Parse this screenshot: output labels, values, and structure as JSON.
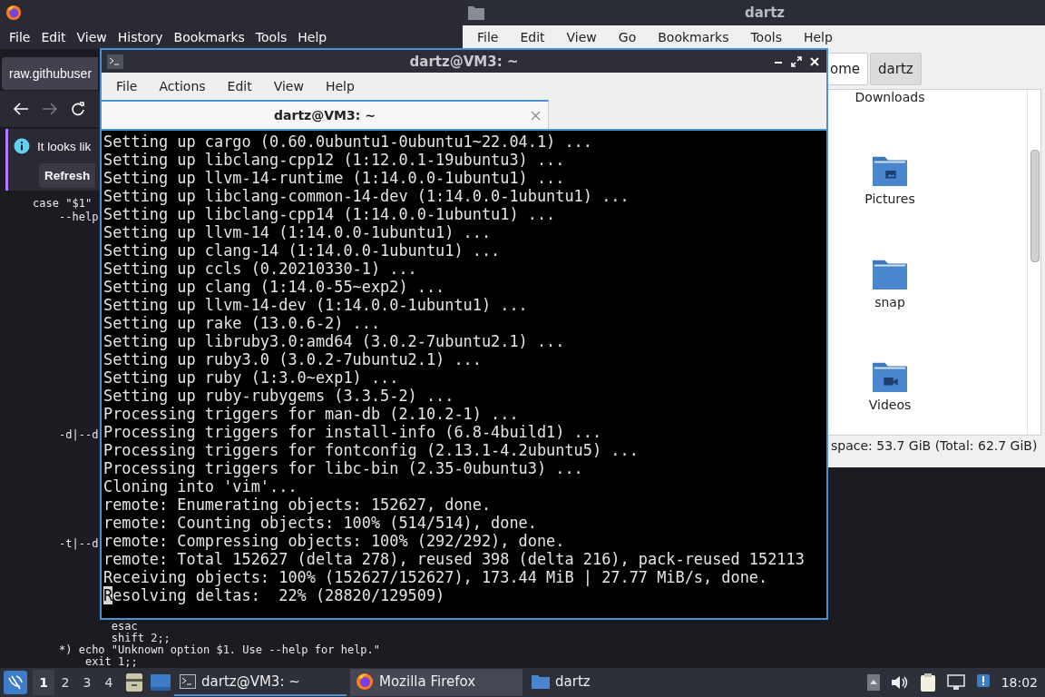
{
  "browser": {
    "menu": [
      "File",
      "Edit",
      "View",
      "History",
      "Bookmarks",
      "Tools",
      "Help"
    ],
    "tab": {
      "title": "raw.githubuser"
    },
    "notification": {
      "text": "It looks lik",
      "button": "Refresh"
    },
    "code_lines": [
      "     case \"$1\"",
      "         --help",
      "         -d|--d",
      "         -t|--d",
      "                 esac",
      "                 shift 2;;",
      "         *) echo \"Unknown option $1. Use --help for help.\"",
      "             exit 1;;"
    ]
  },
  "file_manager": {
    "title": "dartz",
    "menu": [
      "File",
      "Edit",
      "View",
      "Go",
      "Bookmarks",
      "Tools",
      "Help"
    ],
    "path": [
      {
        "label": "ome",
        "selected": false
      },
      {
        "label": "dartz",
        "selected": true
      }
    ],
    "items": [
      {
        "name": "Downloads"
      },
      {
        "name": "Pictures",
        "kind": "pictures"
      },
      {
        "name": "snap",
        "kind": "plain"
      },
      {
        "name": "Videos",
        "kind": "videos"
      }
    ],
    "status": "space: 53.7 GiB (Total: 62.7 GiB)"
  },
  "terminal": {
    "title": "dartz@VM3: ~",
    "menu": [
      "File",
      "Actions",
      "Edit",
      "View",
      "Help"
    ],
    "tab": "dartz@VM3: ~",
    "lines": [
      "Setting up cargo (0.60.0ubuntu1-0ubuntu1~22.04.1) ...",
      "Setting up libclang-cpp12 (1:12.0.1-19ubuntu3) ...",
      "Setting up llvm-14-runtime (1:14.0.0-1ubuntu1) ...",
      "Setting up libclang-common-14-dev (1:14.0.0-1ubuntu1) ...",
      "Setting up libclang-cpp14 (1:14.0.0-1ubuntu1) ...",
      "Setting up llvm-14 (1:14.0.0-1ubuntu1) ...",
      "Setting up clang-14 (1:14.0.0-1ubuntu1) ...",
      "Setting up ccls (0.20210330-1) ...",
      "Setting up clang (1:14.0-55~exp2) ...",
      "Setting up llvm-14-dev (1:14.0.0-1ubuntu1) ...",
      "Setting up rake (13.0.6-2) ...",
      "Setting up libruby3.0:amd64 (3.0.2-7ubuntu2.1) ...",
      "Setting up ruby3.0 (3.0.2-7ubuntu2.1) ...",
      "Setting up ruby (1:3.0~exp1) ...",
      "Setting up ruby-rubygems (3.3.5-2) ...",
      "Processing triggers for man-db (2.10.2-1) ...",
      "Processing triggers for install-info (6.8-4build1) ...",
      "Processing triggers for fontconfig (2.13.1-4.2ubuntu5) ...",
      "Processing triggers for libc-bin (2.35-0ubuntu3) ...",
      "Cloning into 'vim'...",
      "remote: Enumerating objects: 152627, done.",
      "remote: Counting objects: 100% (514/514), done.",
      "remote: Compressing objects: 100% (292/292), done.",
      "remote: Total 152627 (delta 278), reused 398 (delta 216), pack-reused 152113",
      "Receiving objects: 100% (152627/152627), 173.44 MiB | 27.77 MiB/s, done."
    ],
    "cursor_line": "Resolving deltas:  22% (28820/129509)"
  },
  "taskbar": {
    "workspaces": [
      {
        "label": "1",
        "selected": true
      },
      {
        "label": "2",
        "selected": false
      },
      {
        "label": "3",
        "selected": false
      },
      {
        "label": "4",
        "selected": false
      }
    ],
    "tasks": [
      {
        "label": "dartz@VM3: ~",
        "kind": "terminal",
        "selected": true
      },
      {
        "label": "Mozilla Firefox",
        "kind": "firefox",
        "selected": false
      },
      {
        "label": "dartz",
        "kind": "folder",
        "selected": false
      }
    ],
    "clock": "18:02"
  }
}
